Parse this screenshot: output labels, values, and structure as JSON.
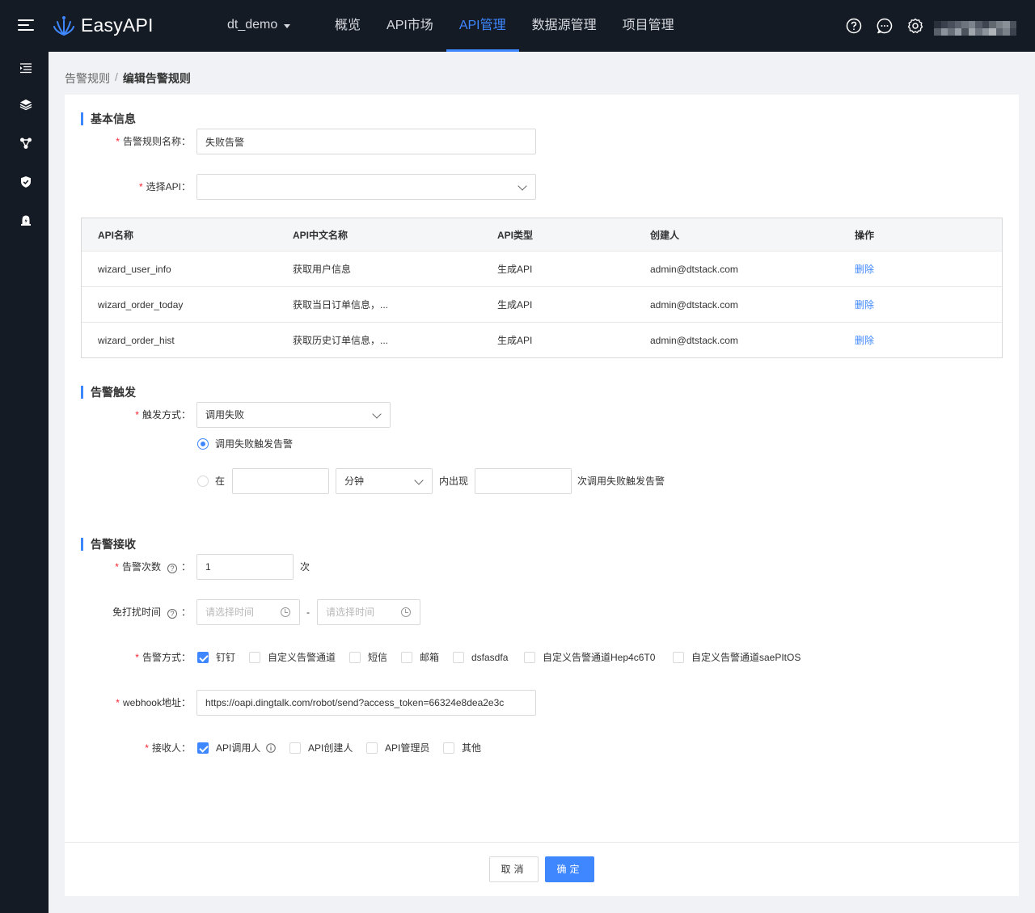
{
  "app": {
    "name": "EasyAPI",
    "project": "dt_demo"
  },
  "nav": {
    "items": [
      "概览",
      "API市场",
      "API管理",
      "数据源管理",
      "项目管理"
    ],
    "active": "API管理"
  },
  "breadcrumb": {
    "parent": "告警规则",
    "separator": "/",
    "current": "编辑告警规则"
  },
  "basic": {
    "title": "基本信息",
    "name_label": "告警规则名称",
    "name_value": "失败告警",
    "api_label": "选择API",
    "api_value": ""
  },
  "table": {
    "headers": [
      "API名称",
      "API中文名称",
      "API类型",
      "创建人",
      "操作"
    ],
    "rows": [
      {
        "name": "wizard_user_info",
        "cn_name": "获取用户信息",
        "type": "生成API",
        "creator": "admin@dtstack.com",
        "action": "删除"
      },
      {
        "name": "wizard_order_today",
        "cn_name": "获取当日订单信息，...",
        "type": "生成API",
        "creator": "admin@dtstack.com",
        "action": "删除"
      },
      {
        "name": "wizard_order_hist",
        "cn_name": "获取历史订单信息，...",
        "type": "生成API",
        "creator": "admin@dtstack.com",
        "action": "删除"
      }
    ]
  },
  "trigger": {
    "title": "告警触发",
    "mode_label": "触发方式",
    "mode_value": "调用失败",
    "option1": "调用失败触发告警",
    "option2_prefix": "在",
    "option2_unit": "分钟",
    "option2_mid": "内出现",
    "option2_suffix": "次调用失败触发告警",
    "selected_option": 1
  },
  "receive": {
    "title": "告警接收",
    "count_label": "告警次数",
    "count_value": "1",
    "count_unit": "次",
    "quiet_label": "免打扰时间",
    "quiet_start_placeholder": "请选择时间",
    "quiet_end_placeholder": "请选择时间",
    "quiet_sep": "-",
    "method_label": "告警方式",
    "methods": [
      {
        "label": "钉钉",
        "checked": true
      },
      {
        "label": "自定义告警通道",
        "checked": false
      },
      {
        "label": "短信",
        "checked": false
      },
      {
        "label": "邮箱",
        "checked": false
      },
      {
        "label": "dsfasdfa",
        "checked": false
      },
      {
        "label": "自定义告警通道Hep4c6T0",
        "checked": false
      },
      {
        "label": "自定义告警通道saePItOS",
        "checked": false
      }
    ],
    "webhook_label": "webhook地址",
    "webhook_value": "https://oapi.dingtalk.com/robot/send?access_token=66324e8dea2e3c",
    "receiver_label": "接收人",
    "receivers": [
      {
        "label": "API调用人",
        "checked": true
      },
      {
        "label": "API创建人",
        "checked": false
      },
      {
        "label": "API管理员",
        "checked": false
      },
      {
        "label": "其他",
        "checked": false
      }
    ]
  },
  "footer": {
    "cancel": "取消",
    "confirm": "确定"
  },
  "colors": {
    "accent": "#3f87ff",
    "nav_bg": "#151b25",
    "required": "#f5222d"
  }
}
